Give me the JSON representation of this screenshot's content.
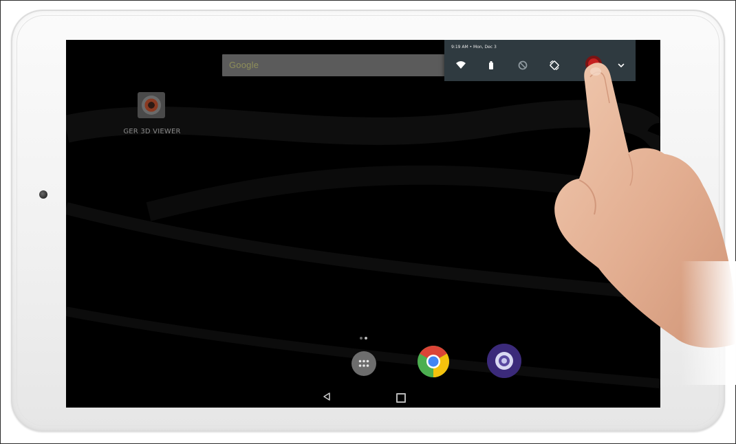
{
  "search": {
    "logo_text": "Google"
  },
  "desktop": {
    "app_label": "GER 3D VIEWER"
  },
  "notification_panel": {
    "time_date": "9:19 AM • Mon, Dec 3"
  },
  "icons": {
    "wifi": "wifi-icon",
    "battery": "battery-icon",
    "dnd": "do-not-disturb-icon",
    "rotate": "auto-rotate-icon",
    "record": "screen-record-icon",
    "expand": "chevron-down-icon",
    "launcher": "app-drawer-icon",
    "chrome": "chrome-icon",
    "camera": "camera-app-icon",
    "back": "back-icon",
    "home": "home-icon"
  },
  "colors": {
    "screen_bg": "#000000",
    "panel_bg": "#2f3a40",
    "record_button": "#b01c1c",
    "tablet_bezel": "#f3f3f3"
  }
}
